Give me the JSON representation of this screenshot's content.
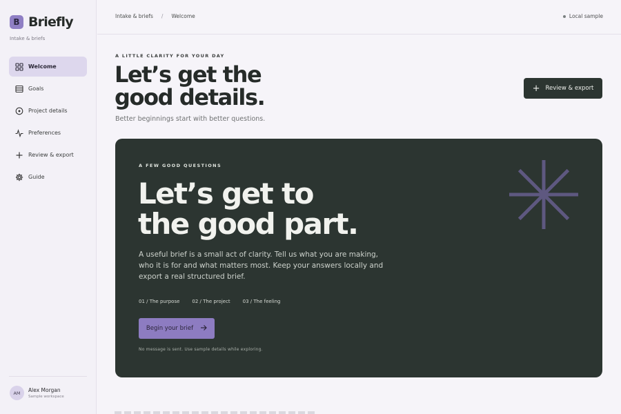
{
  "brand": {
    "mark": "B",
    "name": "Briefly",
    "subtitle": "Intake & briefs"
  },
  "nav": [
    {
      "label": "Welcome",
      "icon": "grid-icon",
      "active": true
    },
    {
      "label": "Goals",
      "icon": "list-icon"
    },
    {
      "label": "Project details",
      "icon": "clock-icon"
    },
    {
      "label": "Preferences",
      "icon": "pulse-icon"
    },
    {
      "label": "Review & export",
      "icon": "plus-icon"
    },
    {
      "label": "Guide",
      "icon": "gear-icon"
    }
  ],
  "user": {
    "initials": "AM",
    "name": "Alex Morgan",
    "workspace": "Sample workspace"
  },
  "topbar": {
    "breadcrumb": [
      "Intake & briefs",
      "Welcome"
    ],
    "separator": "/",
    "status": "Local sample"
  },
  "hero": {
    "eyebrow": "A LITTLE CLARITY FOR YOUR DAY",
    "title": "Let’s get the good details.",
    "subtitle": "Better beginnings start with better questions.",
    "action_label": "Review & export"
  },
  "card": {
    "eyebrow": "A FEW GOOD QUESTIONS",
    "title": "Let’s get to the good part.",
    "description": "A useful brief is a small act of clarity. Tell us what you are making, who it is for and what matters most. Keep your answers locally and export a real structured brief.",
    "steps": [
      "01 / The purpose",
      "02 / The project",
      "03 / The feeling"
    ],
    "cta_label": "Begin your brief",
    "note": "No message is sent. Use sample details while exploring."
  },
  "colors": {
    "accent": "#8d7cc1",
    "dark": "#2c3531",
    "background": "#f6f4f9",
    "burst": "#5e5880"
  }
}
